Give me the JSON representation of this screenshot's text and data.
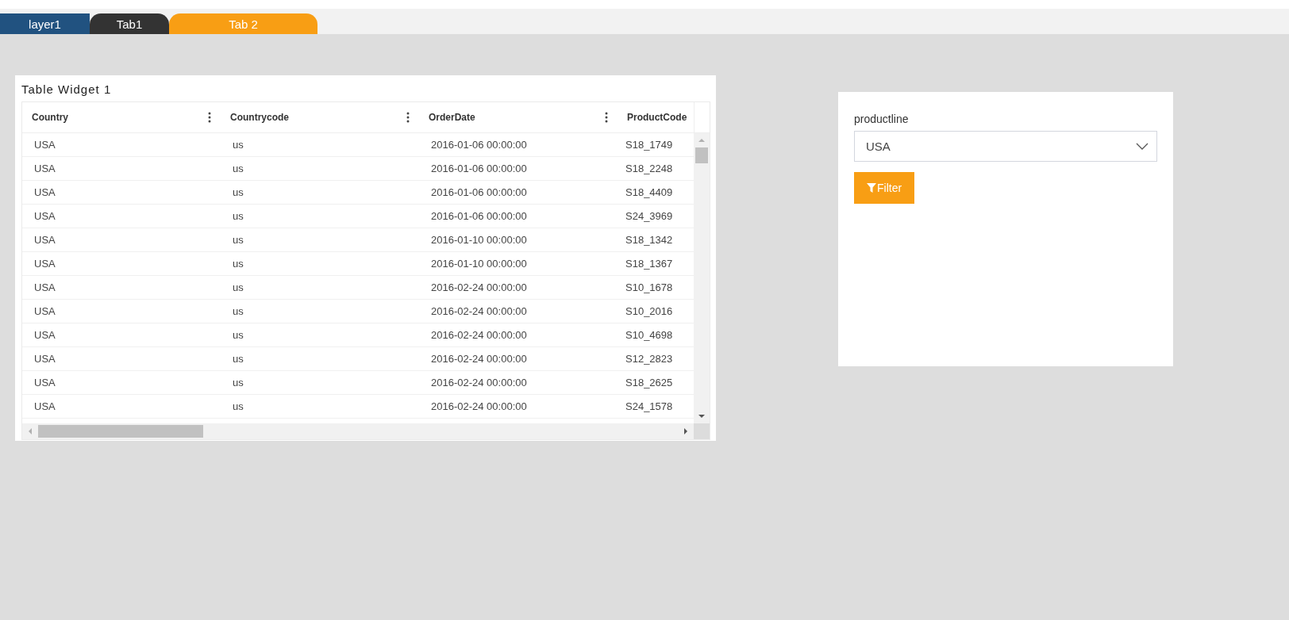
{
  "layer": {
    "label": "layer1"
  },
  "tabs": [
    {
      "label": "Tab1",
      "selected": false
    },
    {
      "label": "Tab 2",
      "selected": true
    }
  ],
  "table_widget": {
    "title": "Table Widget 1",
    "columns": [
      "Country",
      "Countrycode",
      "OrderDate",
      "ProductCode"
    ],
    "rows": [
      [
        "USA",
        "us",
        "2016-01-06 00:00:00",
        "S18_1749"
      ],
      [
        "USA",
        "us",
        "2016-01-06 00:00:00",
        "S18_2248"
      ],
      [
        "USA",
        "us",
        "2016-01-06 00:00:00",
        "S18_4409"
      ],
      [
        "USA",
        "us",
        "2016-01-06 00:00:00",
        "S24_3969"
      ],
      [
        "USA",
        "us",
        "2016-01-10 00:00:00",
        "S18_1342"
      ],
      [
        "USA",
        "us",
        "2016-01-10 00:00:00",
        "S18_1367"
      ],
      [
        "USA",
        "us",
        "2016-02-24 00:00:00",
        "S10_1678"
      ],
      [
        "USA",
        "us",
        "2016-02-24 00:00:00",
        "S10_2016"
      ],
      [
        "USA",
        "us",
        "2016-02-24 00:00:00",
        "S10_4698"
      ],
      [
        "USA",
        "us",
        "2016-02-24 00:00:00",
        "S12_2823"
      ],
      [
        "USA",
        "us",
        "2016-02-24 00:00:00",
        "S18_2625"
      ],
      [
        "USA",
        "us",
        "2016-02-24 00:00:00",
        "S24_1578"
      ]
    ]
  },
  "filter_widget": {
    "label": "productline",
    "value": "USA",
    "button": "Filter"
  }
}
